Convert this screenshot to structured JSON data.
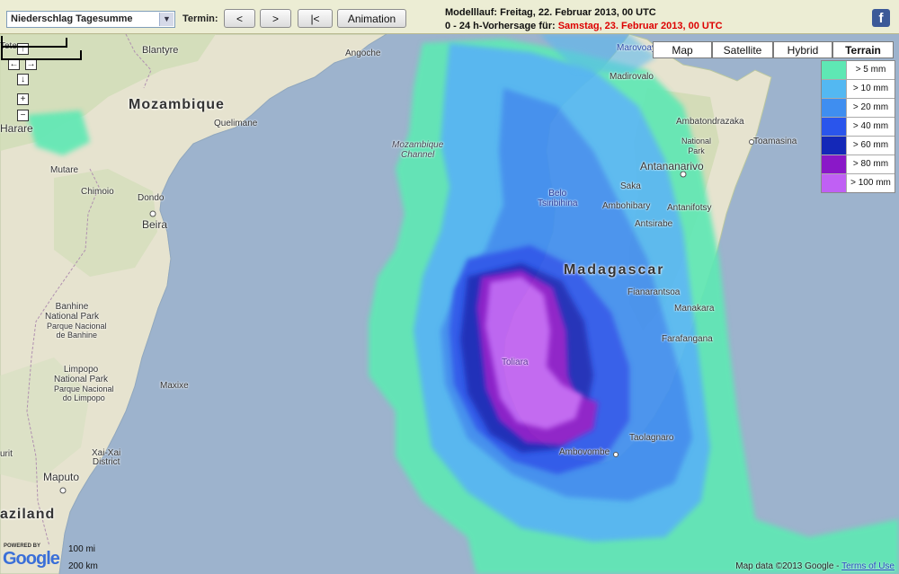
{
  "toolbar": {
    "parameter_select": "Niederschlag Tagesumme",
    "termin_label": "Termin:",
    "prev_button": "<",
    "next_button": ">",
    "first_button": "|<",
    "animation_button": "Animation",
    "model_run": "Modelllauf: Freitag, 22. Februar 2013, 00 UTC",
    "forecast_prefix": "0 - 24 h-Vorhersage für: ",
    "forecast_date": "Samstag, 23. Februar 2013, 00 UTC",
    "facebook_icon": "facebook-icon",
    "facebook_glyph": "f"
  },
  "map_types": [
    {
      "label": "Map",
      "active": false
    },
    {
      "label": "Satellite",
      "active": false
    },
    {
      "label": "Hybrid",
      "active": false
    },
    {
      "label": "Terrain",
      "active": true
    }
  ],
  "legend": [
    {
      "label": "> 5 mm",
      "color": "#5ee8b4"
    },
    {
      "label": "> 10 mm",
      "color": "#53b8f2"
    },
    {
      "label": "> 20 mm",
      "color": "#3f8ef0"
    },
    {
      "label": "> 40 mm",
      "color": "#2a55ec"
    },
    {
      "label": "> 60 mm",
      "color": "#1428b8"
    },
    {
      "label": "> 80 mm",
      "color": "#8a18c8"
    },
    {
      "label": "> 100 mm",
      "color": "#c060f4"
    }
  ],
  "nav_controls": {
    "up": "↑",
    "left": "←",
    "right": "→",
    "down": "↓",
    "zoom_in": "+",
    "zoom_out": "−"
  },
  "places": {
    "tete": "Tete",
    "blantyre": "Blantyre",
    "angoche": "Angoche",
    "harare": "Harare",
    "quelimane": "Quelimane",
    "mutare": "Mutare",
    "chimoio": "Chimoio",
    "dondo": "Dondo",
    "beira": "Beira",
    "banhine": "Banhine\nNational Park",
    "banhine_pt": "Parque Nacional\nde Banhine",
    "limpopo": "Limpopo\nNational Park",
    "limpopo_pt": "Parque Nacional\ndo Limpopo",
    "maxixe": "Maxixe",
    "xai_xai": "Xai-Xai\nDistrict",
    "maputo": "Maputo",
    "moz_channel": "Mozambique\nChannel",
    "marovoay": "Marovoay",
    "madirovalo": "Madirovalo",
    "ambatondrazaka": "Ambatondrazaka",
    "national_park": "National\nPark",
    "toamasina": "Toamasina",
    "antananarivo": "Antananarivo",
    "belo": "Belo\nTsiribihina",
    "saka": "Saka",
    "ambohibary": "Ambohibary",
    "antanifotsy": "Antanifotsy",
    "antsirabe": "Antsirabe",
    "fianarantsoa": "Fianarantsoa",
    "manakara": "Manakara",
    "farafangana": "Farafangana",
    "toliara": "Toliara",
    "taolagnaro": "Taolagnaro",
    "ambovombe": "Ambovombe",
    "urit": "urit",
    "pointer_o": "o"
  },
  "countries": {
    "mozambique": "Mozambique",
    "madagascar": "Madagascar",
    "swaziland": "aziland"
  },
  "scale": {
    "miles": "100 mi",
    "km": "200 km"
  },
  "branding": {
    "powered": "POWERED BY",
    "google": "Google"
  },
  "attribution": {
    "text": "Map data ©2013 Google - ",
    "link": "Terms of Use"
  }
}
